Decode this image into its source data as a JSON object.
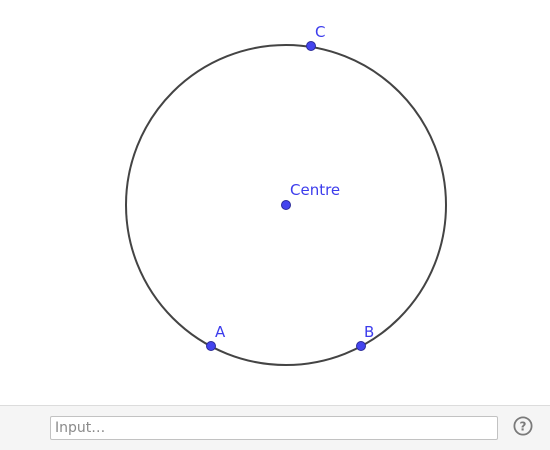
{
  "colors": {
    "point_fill": "#4444ee",
    "point_stroke": "#2a2a9a",
    "label": "#3c3cec",
    "circle_stroke": "#444444",
    "help_icon": "#7a7a7a"
  },
  "points": {
    "centre": {
      "label": "Centre"
    },
    "a": {
      "label": "A"
    },
    "b": {
      "label": "B"
    },
    "c": {
      "label": "C"
    }
  },
  "input_bar": {
    "placeholder": "Input…"
  },
  "help": {
    "icon": "question-mark-icon",
    "glyph": "?"
  }
}
